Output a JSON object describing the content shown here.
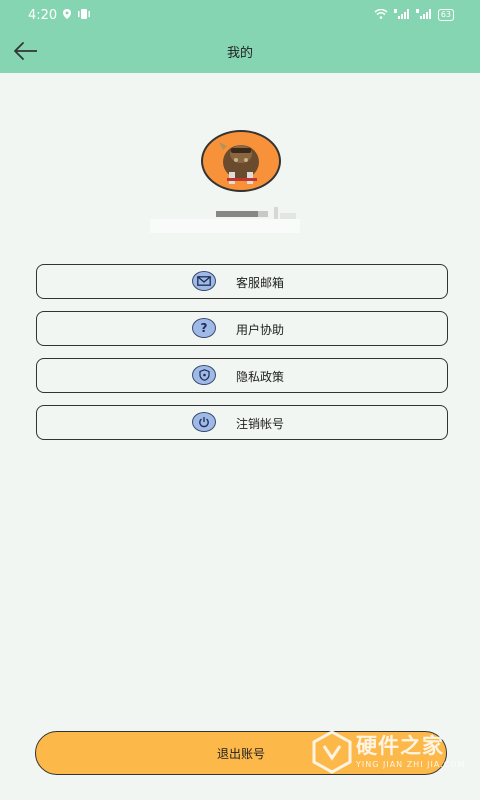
{
  "status_bar": {
    "time": "4:20",
    "battery": "63"
  },
  "app_bar": {
    "title": "我的",
    "back_icon": "arrow-left-icon"
  },
  "profile": {
    "avatar_icon": "game-character-avatar",
    "username_redacted": true
  },
  "menu": [
    {
      "label": "客服邮箱",
      "icon": "mail-icon"
    },
    {
      "label": "用户协助",
      "icon": "question-icon"
    },
    {
      "label": "隐私政策",
      "icon": "shield-icon"
    },
    {
      "label": "注销帐号",
      "icon": "power-icon"
    }
  ],
  "logout_label": "退出账号",
  "watermark": {
    "text": "硬件之家",
    "sub": "YING JIAN ZHI JIA.COM"
  },
  "colors": {
    "header": "#86d5b2",
    "background": "#f1f6f2",
    "logout": "#fdb84a",
    "icon_fill": "#9fb9e8"
  }
}
